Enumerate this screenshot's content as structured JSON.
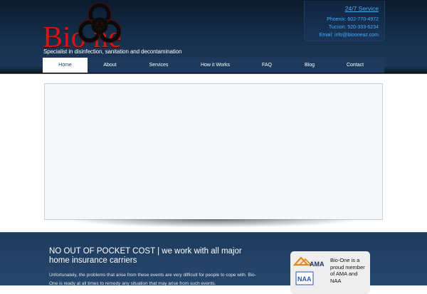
{
  "header": {
    "logo_text": "Bio  ne",
    "tagline": "Specialist in disinfection, sanitation and decontamination"
  },
  "contact": {
    "service": "24/7 Service",
    "phoenix": "Phoenix: 602-770-4972",
    "tucson": "Tucson: 520-333-6234",
    "email": "Email: info@biooneaz.com"
  },
  "nav": {
    "items": [
      "Home",
      "About",
      "Services",
      "How it Works",
      "FAQ",
      "Blog",
      "Contact"
    ],
    "active": "Home"
  },
  "main": {
    "headline": "NO OUT OF POCKET COST | we work with all major home insurance carriers",
    "body": "Unfortunately, the problems that arise from these events are very difficult for people to cope with. Bio-One is ready at all times to remedy any situation that may arise from such events."
  },
  "membership": {
    "text": "Bio-One is a proud member of AMA and NAA",
    "ama_label": "AMA",
    "naa_label": "NAA"
  },
  "colors": {
    "brand_red": "#d01818",
    "link_blue": "#3fb0ff",
    "nav_bg": "#1d3a5c"
  }
}
